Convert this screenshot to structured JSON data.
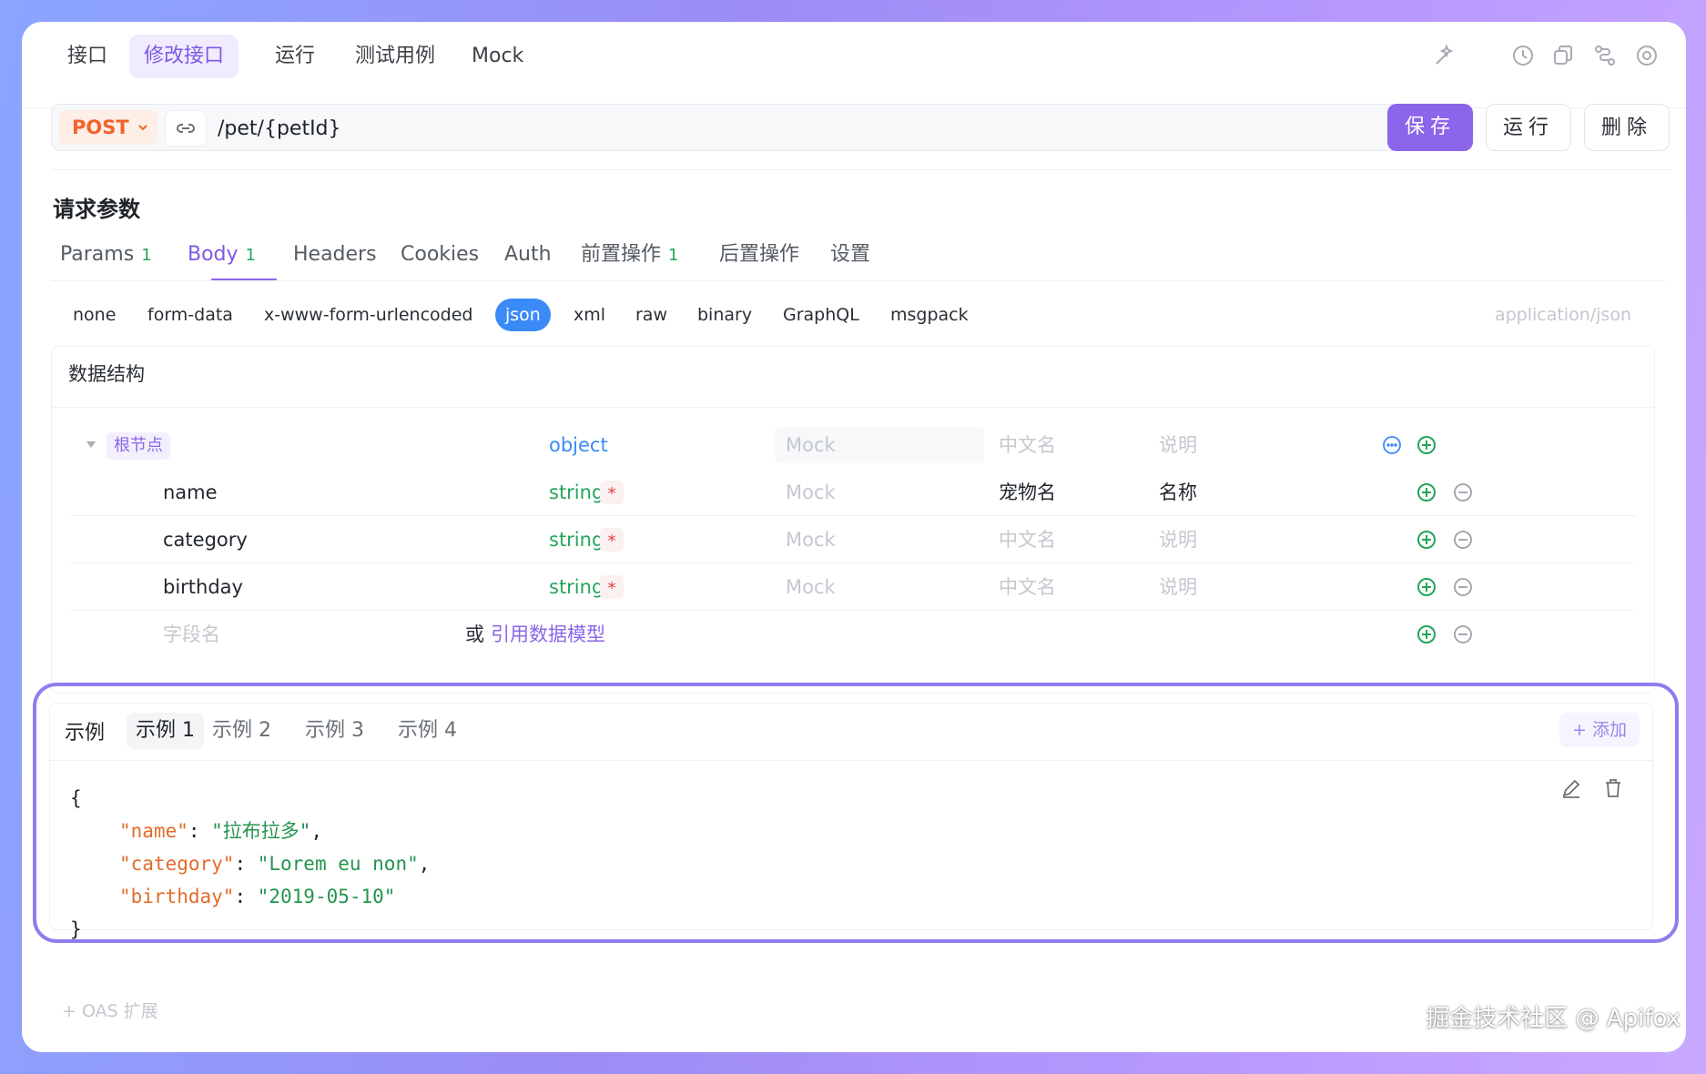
{
  "top_tabs": [
    "接口",
    "修改接口",
    "运行",
    "测试用例",
    "Mock"
  ],
  "request": {
    "method": "POST",
    "path": "/pet/{petId}",
    "save_label": "保存",
    "run_label": "运行",
    "delete_label": "删除"
  },
  "section_title": "请求参数",
  "param_tabs": [
    {
      "label": "Params",
      "badge": "1"
    },
    {
      "label": "Body",
      "badge": "1"
    },
    {
      "label": "Headers",
      "badge": ""
    },
    {
      "label": "Cookies",
      "badge": ""
    },
    {
      "label": "Auth",
      "badge": ""
    },
    {
      "label": "前置操作",
      "badge": "1"
    },
    {
      "label": "后置操作",
      "badge": ""
    },
    {
      "label": "设置",
      "badge": ""
    }
  ],
  "body_types": [
    "none",
    "form-data",
    "x-www-form-urlencoded",
    "json",
    "xml",
    "raw",
    "binary",
    "GraphQL",
    "msgpack"
  ],
  "content_type": "application/json",
  "data_structure": {
    "title": "数据结构",
    "root": {
      "label": "根节点",
      "type": "object",
      "mock_placeholder": "Mock",
      "cn_placeholder": "中文名",
      "desc_placeholder": "说明"
    },
    "fields": [
      {
        "name": "name",
        "type": "string",
        "required": "*",
        "mock": "Mock",
        "cn": "宠物名",
        "desc": "名称"
      },
      {
        "name": "category",
        "type": "string",
        "required": "*",
        "mock": "Mock",
        "cn": "中文名",
        "desc": "说明"
      },
      {
        "name": "birthday",
        "type": "string",
        "required": "*",
        "mock": "Mock",
        "cn": "中文名",
        "desc": "说明"
      }
    ],
    "new_field_placeholder": "字段名",
    "or_text": "或",
    "ref_model_link": "引用数据模型"
  },
  "examples": {
    "label": "示例",
    "tabs": [
      "示例 1",
      "示例 2",
      "示例 3",
      "示例 4"
    ],
    "add_label": "+ 添加",
    "code": {
      "open": "{",
      "lines": [
        {
          "key": "\"name\"",
          "value": "\"拉布拉多\"",
          "comma": ","
        },
        {
          "key": "\"category\"",
          "value": "\"Lorem eu non\"",
          "comma": ","
        },
        {
          "key": "\"birthday\"",
          "value": "\"2019-05-10\"",
          "comma": ""
        }
      ],
      "close": "}"
    }
  },
  "oas_ext": "+ OAS 扩展",
  "watermark": "掘金技术社区 @ Apifox"
}
